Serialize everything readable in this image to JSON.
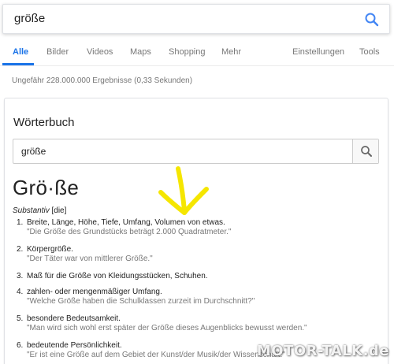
{
  "search": {
    "query": "größe"
  },
  "tabs": [
    {
      "label": "Alle",
      "active": true
    },
    {
      "label": "Bilder"
    },
    {
      "label": "Videos"
    },
    {
      "label": "Maps"
    },
    {
      "label": "Shopping"
    },
    {
      "label": "Mehr"
    },
    {
      "label": "Einstellungen"
    },
    {
      "label": "Tools"
    }
  ],
  "result_stats": "Ungefähr 228.000.000 Ergebnisse (0,33 Sekunden)",
  "dictionary": {
    "title": "Wörterbuch",
    "search_value": "größe",
    "headword": "Grö·ße",
    "pos_label": "Substantiv",
    "gender": "[die]",
    "definitions": [
      {
        "num": "1.",
        "text": "Breite, Länge, Höhe, Tiefe, Umfang, Volumen von etwas.",
        "example": "\"Die Größe des Grundstücks beträgt 2.000 Quadratmeter.\""
      },
      {
        "num": "2.",
        "text": "Körpergröße.",
        "example": "\"Der Täter war von mittlerer Größe.\""
      },
      {
        "num": "3.",
        "text": "Maß für die Größe von Kleidungsstücken, Schuhen.",
        "example": ""
      },
      {
        "num": "4.",
        "text": "zahlen- oder mengenmäßiger Umfang.",
        "example": "\"Welche Größe haben die Schulklassen zurzeit im Durchschnitt?\""
      },
      {
        "num": "5.",
        "text": "besondere Bedeutsamkeit.",
        "example": "\"Man wird sich wohl erst später der Größe dieses Augenblicks bewusst werden.\""
      },
      {
        "num": "6.",
        "text": "bedeutende Persönlichkeit.",
        "example": "\"Er ist eine Größe auf dem Gebiet der Kunst/der Musik/der Wissenschaft.\""
      }
    ]
  },
  "watermark": "MOTOR-TALK.de",
  "colors": {
    "accent": "#1a73e8",
    "annotation": "#f5e600"
  }
}
